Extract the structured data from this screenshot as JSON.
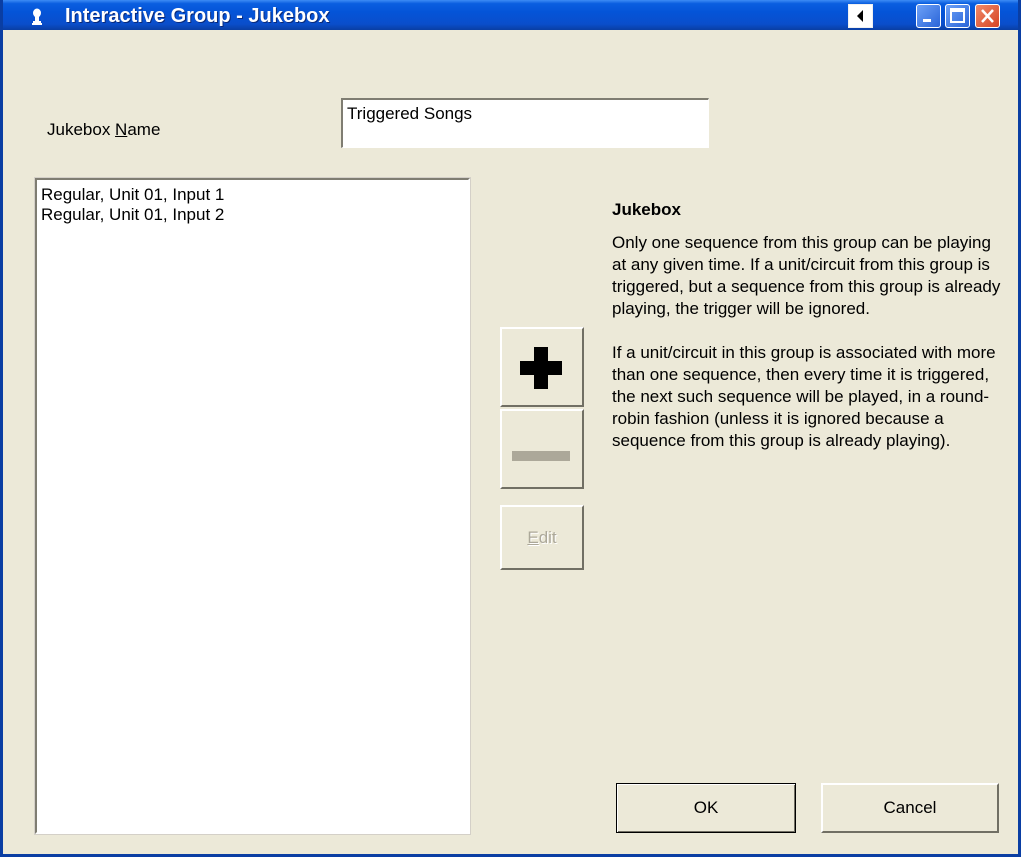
{
  "window": {
    "title": "Interactive Group - Jukebox"
  },
  "form": {
    "name_label_pre": "Jukebox ",
    "name_label_mnemonic": "N",
    "name_label_post": "ame",
    "name_value": "Triggered Songs"
  },
  "list": {
    "items": [
      "Regular, Unit 01, Input 1",
      "Regular, Unit 01, Input 2"
    ]
  },
  "buttons": {
    "add_icon": "plus-icon",
    "remove_icon": "minus-icon",
    "edit_mnemonic": "E",
    "edit_rest": "dit",
    "ok": "OK",
    "cancel": "Cancel"
  },
  "help": {
    "title": "Jukebox",
    "paragraph1": "Only one sequence from this group can be playing at any given time.  If a unit/circuit from this group is triggered, but a sequence from this group is already playing, the trigger will be ignored.",
    "paragraph2": "If a unit/circuit in this group is associated with more than one sequence, then every time it is triggered, the next such sequence will be played, in a round-robin fashion (unless it is ignored because a sequence from this group is already playing)."
  },
  "colors": {
    "titlebar": "#0454d8",
    "dialog_face": "#ece9d8",
    "disabled_text": "#aca899"
  }
}
